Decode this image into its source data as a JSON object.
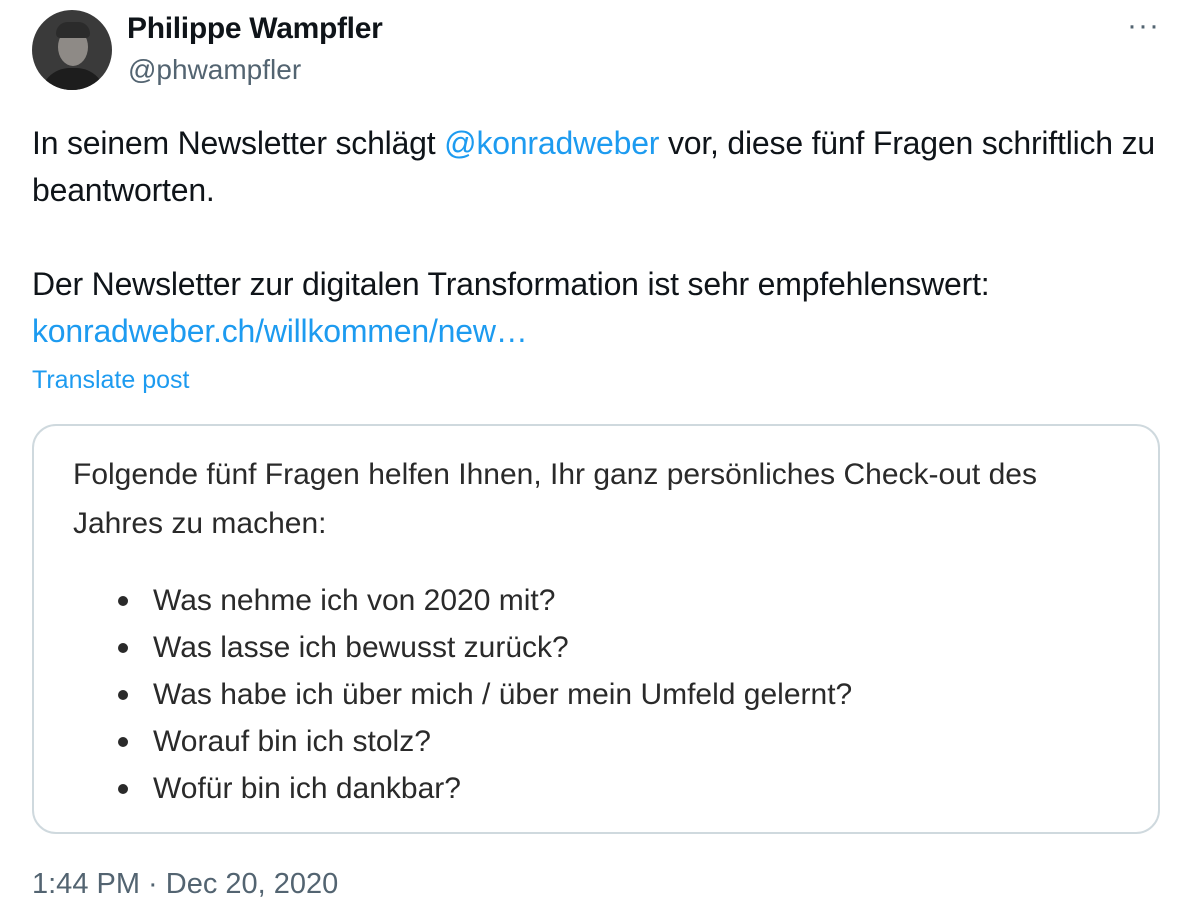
{
  "author": {
    "name": "Philippe Wampfler",
    "handle": "@phwampfler"
  },
  "more_icon": "more-horizontal-icon",
  "post": {
    "line1_pre": "In seinem Newsletter schlägt ",
    "mention": "@konradweber",
    "line1_post": " vor, diese fünf Fragen schriftlich zu beantworten.",
    "line2": "Der Newsletter zur digitalen Transformation ist sehr empfehlenswert:",
    "link": "konradweber.ch/willkommen/new…",
    "translate": "Translate post"
  },
  "card": {
    "intro": "Folgende fünf Fragen helfen Ihnen, Ihr ganz persönliches Check-out des Jahres zu machen:",
    "items": [
      "Was nehme ich von 2020 mit?",
      "Was lasse ich bewusst zurück?",
      "Was habe ich über mich / über mein Umfeld gelernt?",
      "Worauf bin ich stolz?",
      "Wofür bin ich dankbar?"
    ]
  },
  "timestamp": "1:44 PM · Dec 20, 2020",
  "colors": {
    "link": "#1d9bf0",
    "secondary_text": "#536471",
    "border": "#cfd9de"
  }
}
